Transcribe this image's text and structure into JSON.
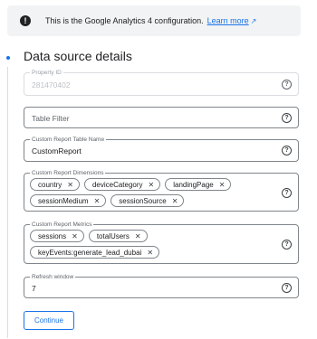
{
  "banner": {
    "message": "This is the Google Analytics 4 configuration.",
    "link_label": "Learn more",
    "info_icon": "info-icon",
    "external_icon": "external-link-icon"
  },
  "section": {
    "title": "Data source details"
  },
  "fields": {
    "property_id": {
      "label": "Property ID",
      "value": "281470402"
    },
    "table_filter": {
      "placeholder": "Table Filter"
    },
    "report_table_name": {
      "label": "Custom Report Table Name",
      "value": "CustomReport"
    },
    "dimensions": {
      "label": "Custom Report Dimensions",
      "chips": [
        "country",
        "deviceCategory",
        "landingPage",
        "sessionMedium",
        "sessionSource"
      ]
    },
    "metrics": {
      "label": "Custom Report Metrics",
      "chips": [
        "sessions",
        "totalUsers",
        "keyEvents:generate_lead_dubai"
      ]
    },
    "refresh_window": {
      "label": "Refresh window",
      "value": "7"
    }
  },
  "actions": {
    "continue_label": "Continue"
  },
  "colors": {
    "accent": "#1a73e8",
    "banner_bg": "#f1f3f4",
    "border": "#80868b"
  }
}
